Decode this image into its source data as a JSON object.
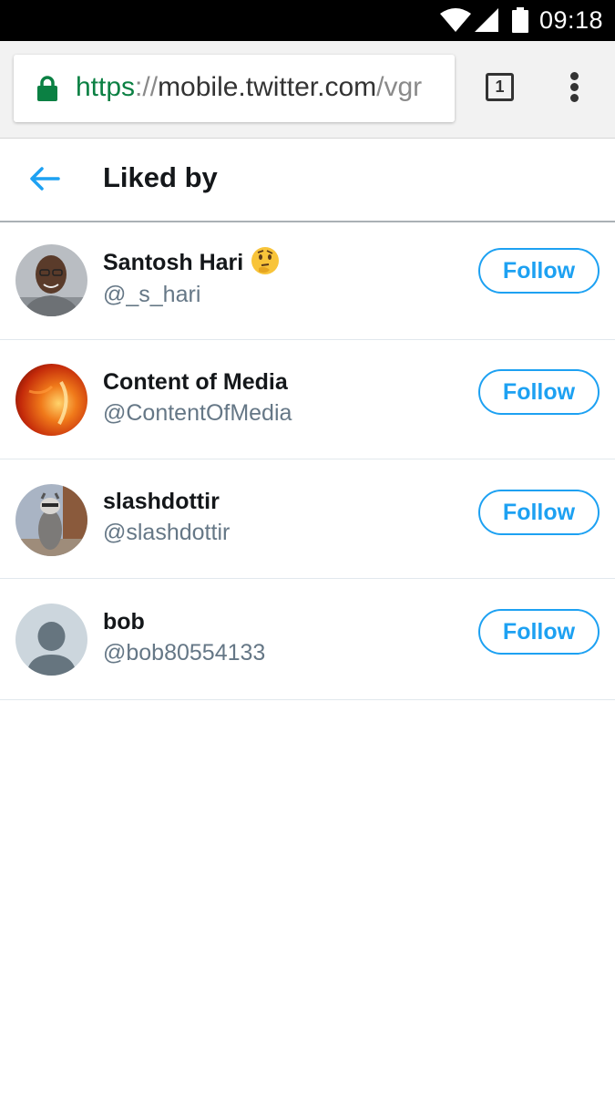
{
  "status_bar": {
    "time": "09:18",
    "icons": [
      "wifi-icon",
      "signal-icon",
      "battery-icon"
    ]
  },
  "browser": {
    "url_scheme": "https",
    "url_separator": "://",
    "url_host": "mobile.twitter.com",
    "url_path": "/vgr",
    "tab_count": "1",
    "icons": [
      "lock-icon",
      "tabs-icon",
      "overflow-menu-icon"
    ]
  },
  "header": {
    "title": "Liked by",
    "back_icon": "arrow-left-icon"
  },
  "users": [
    {
      "name": "Santosh Hari",
      "handle": "@_s_hari",
      "emoji": "thinking-face-emoji",
      "follow_label": "Follow"
    },
    {
      "name": "Content of Media",
      "handle": "@ContentOfMedia",
      "follow_label": "Follow"
    },
    {
      "name": "slashdottir",
      "handle": "@slashdottir",
      "follow_label": "Follow"
    },
    {
      "name": "bob",
      "handle": "@bob80554133",
      "follow_label": "Follow"
    }
  ],
  "colors": {
    "accent": "#1da1f2",
    "secure_green": "#0b8043",
    "handle_gray": "#657786",
    "status_bar": "#000000"
  }
}
